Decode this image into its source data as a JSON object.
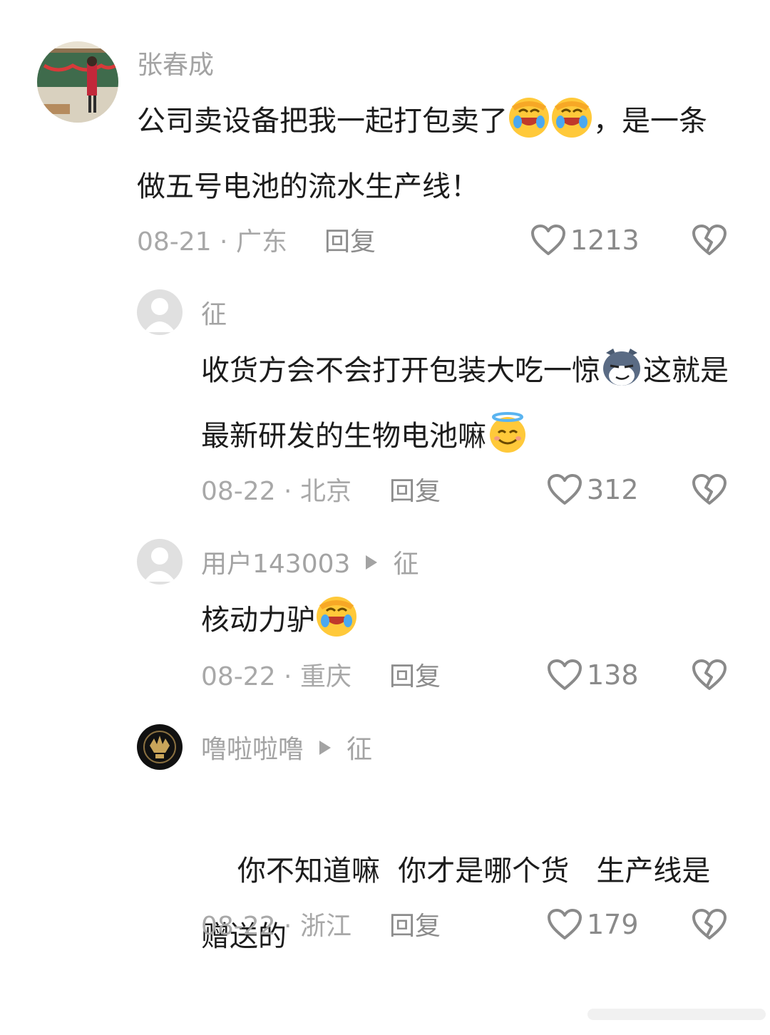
{
  "comments": [
    {
      "username": "张春成",
      "reply_to": "",
      "content_parts": [
        "公司卖设备把我一起打包卖了",
        "，是一条做五号电池的流水生产线！"
      ],
      "emojis": [
        "facepalm-laughing-emoji",
        "facepalm-laughing-emoji"
      ],
      "date_location": "08-21 · 广东",
      "reply_label": "回复",
      "likes": "1213"
    },
    {
      "username": "征",
      "reply_to": "",
      "content_parts": [
        "收货方会不会打开包装大吃一惊",
        "这就是最新研发的生物电池嘛"
      ],
      "emojis": [
        "smirking-dog-emoji",
        "smiling-halo-emoji"
      ],
      "date_location": "08-22 · 北京",
      "reply_label": "回复",
      "likes": "312"
    },
    {
      "username": "用户143003",
      "reply_to": "征",
      "content_parts": [
        "核动力驴"
      ],
      "emojis": [
        "facepalm-laughing-emoji"
      ],
      "date_location": "08-22 · 重庆",
      "reply_label": "回复",
      "likes": "138"
    },
    {
      "username": "噜啦啦噜",
      "reply_to": "征",
      "content_parts": [
        "你不知道嘛  你才是哪个货   生产线是赠送的"
      ],
      "emojis": [],
      "date_location": "08-22 · 浙江",
      "reply_label": "回复",
      "likes": "179"
    }
  ],
  "icons": {
    "like": "heart-outline-icon",
    "dislike": "broken-heart-icon"
  },
  "colors": {
    "text": "#1c1c1c",
    "muted": "#a3a3a3",
    "emoji_yellow": "#ffc93a"
  }
}
